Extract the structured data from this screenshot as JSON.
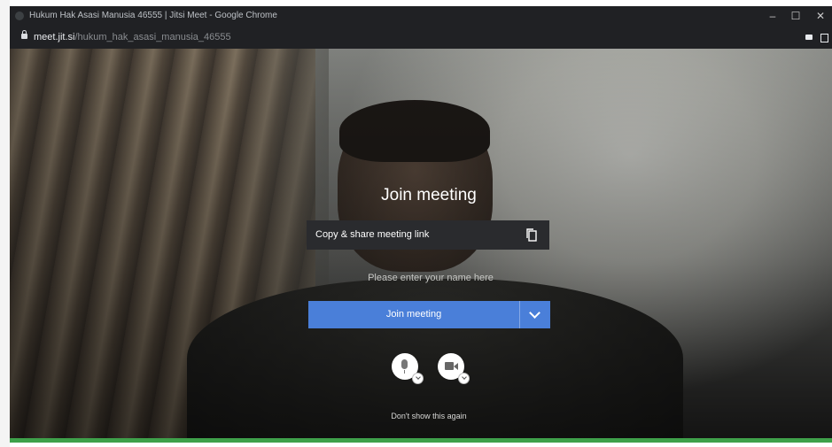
{
  "browser": {
    "window_title": "Hukum Hak Asasi Manusia 46555 | Jitsi Meet - Google Chrome",
    "url_host": "meet.jit.si",
    "url_path": "/hukum_hak_asasi_manusia_46555",
    "controls": {
      "minimize": "–",
      "maximize": "☐",
      "close": "✕"
    }
  },
  "prejoin": {
    "title": "Join meeting",
    "share_link_label": "Copy & share meeting link",
    "name_placeholder": "Please enter your name here",
    "name_value": "",
    "join_button_label": "Join meeting",
    "dont_show_label": "Don't show this again"
  },
  "icons": {
    "copy": "copy-icon",
    "dropdown": "chevron-down-icon",
    "mic": "microphone-icon",
    "camera": "camera-icon"
  },
  "colors": {
    "accent": "#4a7fd9",
    "status_bar": "#3ea04a"
  }
}
